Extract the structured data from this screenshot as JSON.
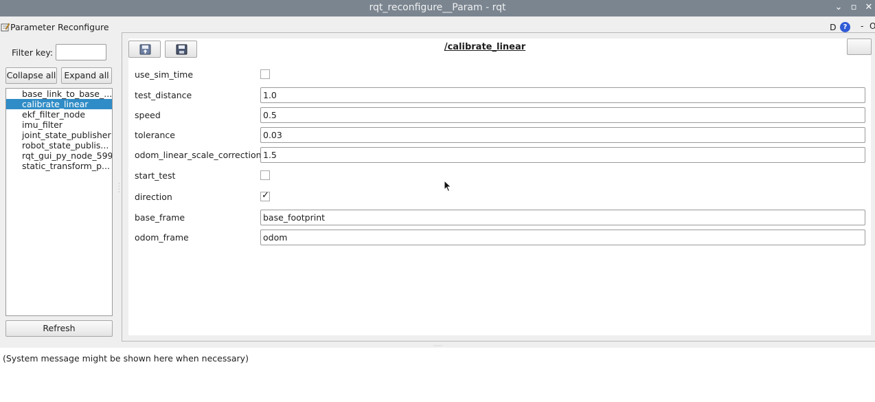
{
  "window": {
    "title": "rqt_reconfigure__Param - rqt"
  },
  "dock": {
    "title": "Parameter Reconfigure",
    "d_label": "D",
    "help_label": "?",
    "dash_label": "-",
    "o_label": "O"
  },
  "left": {
    "filter_label": "Filter key:",
    "filter_value": "",
    "collapse_label": "Collapse all",
    "expand_label": "Expand all",
    "nodes": [
      "base_link_to_base_...",
      "calibrate_linear",
      "ekf_filter_node",
      "imu_filter",
      "joint_state_publisher",
      "robot_state_publis...",
      "rqt_gui_py_node_599",
      "static_transform_p..."
    ],
    "selected_node": "calibrate_linear",
    "refresh_label": "Refresh"
  },
  "editor": {
    "node_name": "/calibrate_linear",
    "params": {
      "use_sim_time": {
        "label": "use_sim_time",
        "checked": false
      },
      "test_distance": {
        "label": "test_distance",
        "value": "1.0"
      },
      "speed": {
        "label": "speed",
        "value": "0.5"
      },
      "tolerance": {
        "label": "tolerance",
        "value": "0.03"
      },
      "odom_linear_scale_correction": {
        "label": "odom_linear_scale_correction",
        "value": "1.5"
      },
      "start_test": {
        "label": "start_test",
        "checked": false
      },
      "direction": {
        "label": "direction",
        "checked": true,
        "tick": "✓"
      },
      "base_frame": {
        "label": "base_frame",
        "value": "base_footprint"
      },
      "odom_frame": {
        "label": "odom_frame",
        "value": "odom"
      }
    }
  },
  "status": {
    "message": "(System message might be shown here when necessary)"
  },
  "colors": {
    "selection": "#308cc6",
    "titlebar": "#7a8590",
    "help": "#2f5bd6"
  }
}
